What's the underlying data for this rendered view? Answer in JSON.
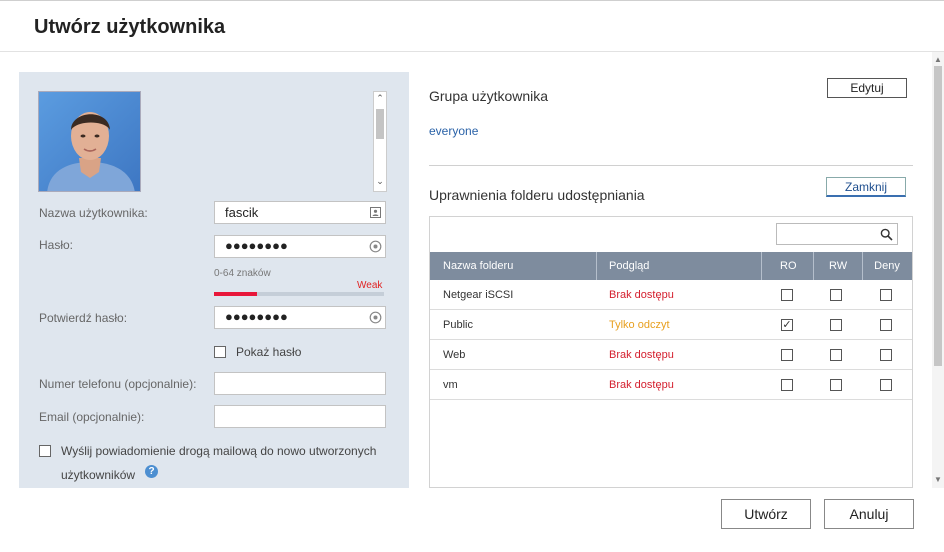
{
  "dialog": {
    "title": "Utwórz użytkownika"
  },
  "form": {
    "username_label": "Nazwa użytkownika:",
    "username_value": "fascik",
    "password_label": "Hasło:",
    "password_mask": "●●●●●●●●",
    "password_hint": "0-64 znaków",
    "strength_label": "Weak",
    "strength_fraction": 0.25,
    "confirm_label": "Potwierdź hasło:",
    "confirm_mask": "●●●●●●●●",
    "show_password_label": "Pokaż hasło",
    "phone_label": "Numer telefonu (opcjonalnie):",
    "phone_value": "",
    "email_label": "Email (opcjonalnie):",
    "email_value": "",
    "notify_label_1": "Wyślij powiadomienie drogą mailową do nowo utworzonych",
    "notify_label_2": "użytkowników",
    "help_glyph": "?"
  },
  "group": {
    "title": "Grupa użytkownika",
    "edit_button": "Edytuj",
    "value": "everyone"
  },
  "folders": {
    "title": "Uprawnienia folderu udostępniania",
    "close_button": "Zamknij",
    "search_placeholder": "",
    "columns": [
      "Nazwa folderu",
      "Podgląd",
      "RO",
      "RW",
      "Deny"
    ],
    "rows": [
      {
        "name": "Netgear iSCSI",
        "preview": "Brak dostępu",
        "ro": false,
        "rw": false,
        "deny": false
      },
      {
        "name": "Public",
        "preview": "Tylko odczyt",
        "ro": true,
        "rw": false,
        "deny": false
      },
      {
        "name": "Web",
        "preview": "Brak dostępu",
        "ro": false,
        "rw": false,
        "deny": false
      },
      {
        "name": "vm",
        "preview": "Brak dostępu",
        "ro": false,
        "rw": false,
        "deny": false
      }
    ]
  },
  "footer": {
    "create_button": "Utwórz",
    "cancel_button": "Anuluj"
  },
  "colors": {
    "accent": "#2a62a8",
    "no_access": "#d41e2d",
    "read_only": "#e8a020",
    "strength_weak": "#e8173a"
  }
}
